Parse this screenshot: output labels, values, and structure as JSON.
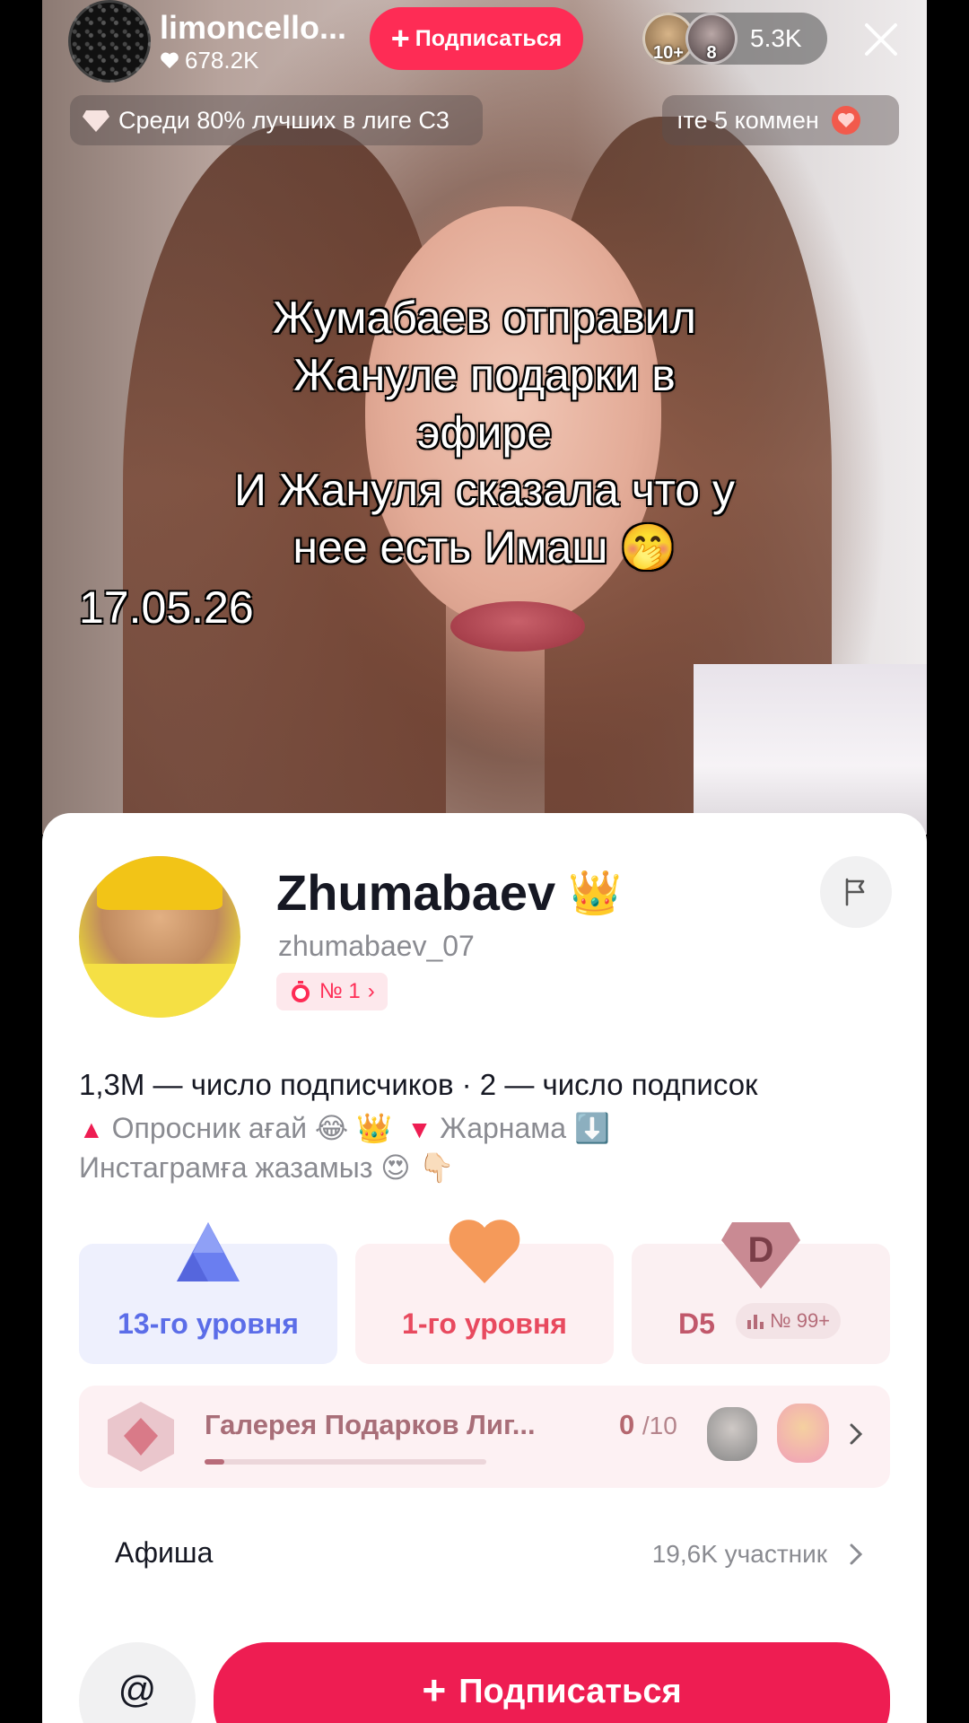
{
  "live_header": {
    "streamer_name": "limoncello...",
    "likes": "678.2K",
    "follow_label": "Подписаться",
    "viewer_badges": [
      "10+",
      "8"
    ],
    "viewer_count": "5.3K",
    "league_text": "Среди 80% лучших в лиге C3",
    "comment_text": "ıте 5 коммен"
  },
  "overlay": {
    "lines": [
      "Жумабаев отправил",
      "Жануле подарки в",
      "эфире",
      "И Жануля сказала что у",
      "нее есть Имаш 🤭"
    ],
    "date": "17.05.26"
  },
  "profile": {
    "name": "Zhumabaev",
    "name_emoji": "👑",
    "handle": "zhumabaev_07",
    "rank_badge": "№ 1",
    "stats": "1,3M — число подписчиков · 2 — число подписок",
    "bio_line1_a": "Опросник ағай 😂 👑",
    "bio_line1_b": "Жарнама ⬇️",
    "bio_line2": "Инстаграмға жазамыз 😍 👇🏻"
  },
  "levels": {
    "card1_label": "13-го уровня",
    "card2_label": "1-го уровня",
    "card3_label": "D5",
    "card3_rank": "№ 99+",
    "card3_icon_letter": "D"
  },
  "gallery": {
    "title": "Галерея Подарков Лиг...",
    "count": "0",
    "total": "/10",
    "progress": 0.07
  },
  "afisha": {
    "title": "Афиша",
    "meta": "19,6K  участник"
  },
  "actions": {
    "mention": "@",
    "follow_label": "Подписаться"
  },
  "colors": {
    "accent": "#fe2c55",
    "follow_big": "#ee1d52",
    "level1": "#5b6de8",
    "level2": "#e84a5f"
  }
}
